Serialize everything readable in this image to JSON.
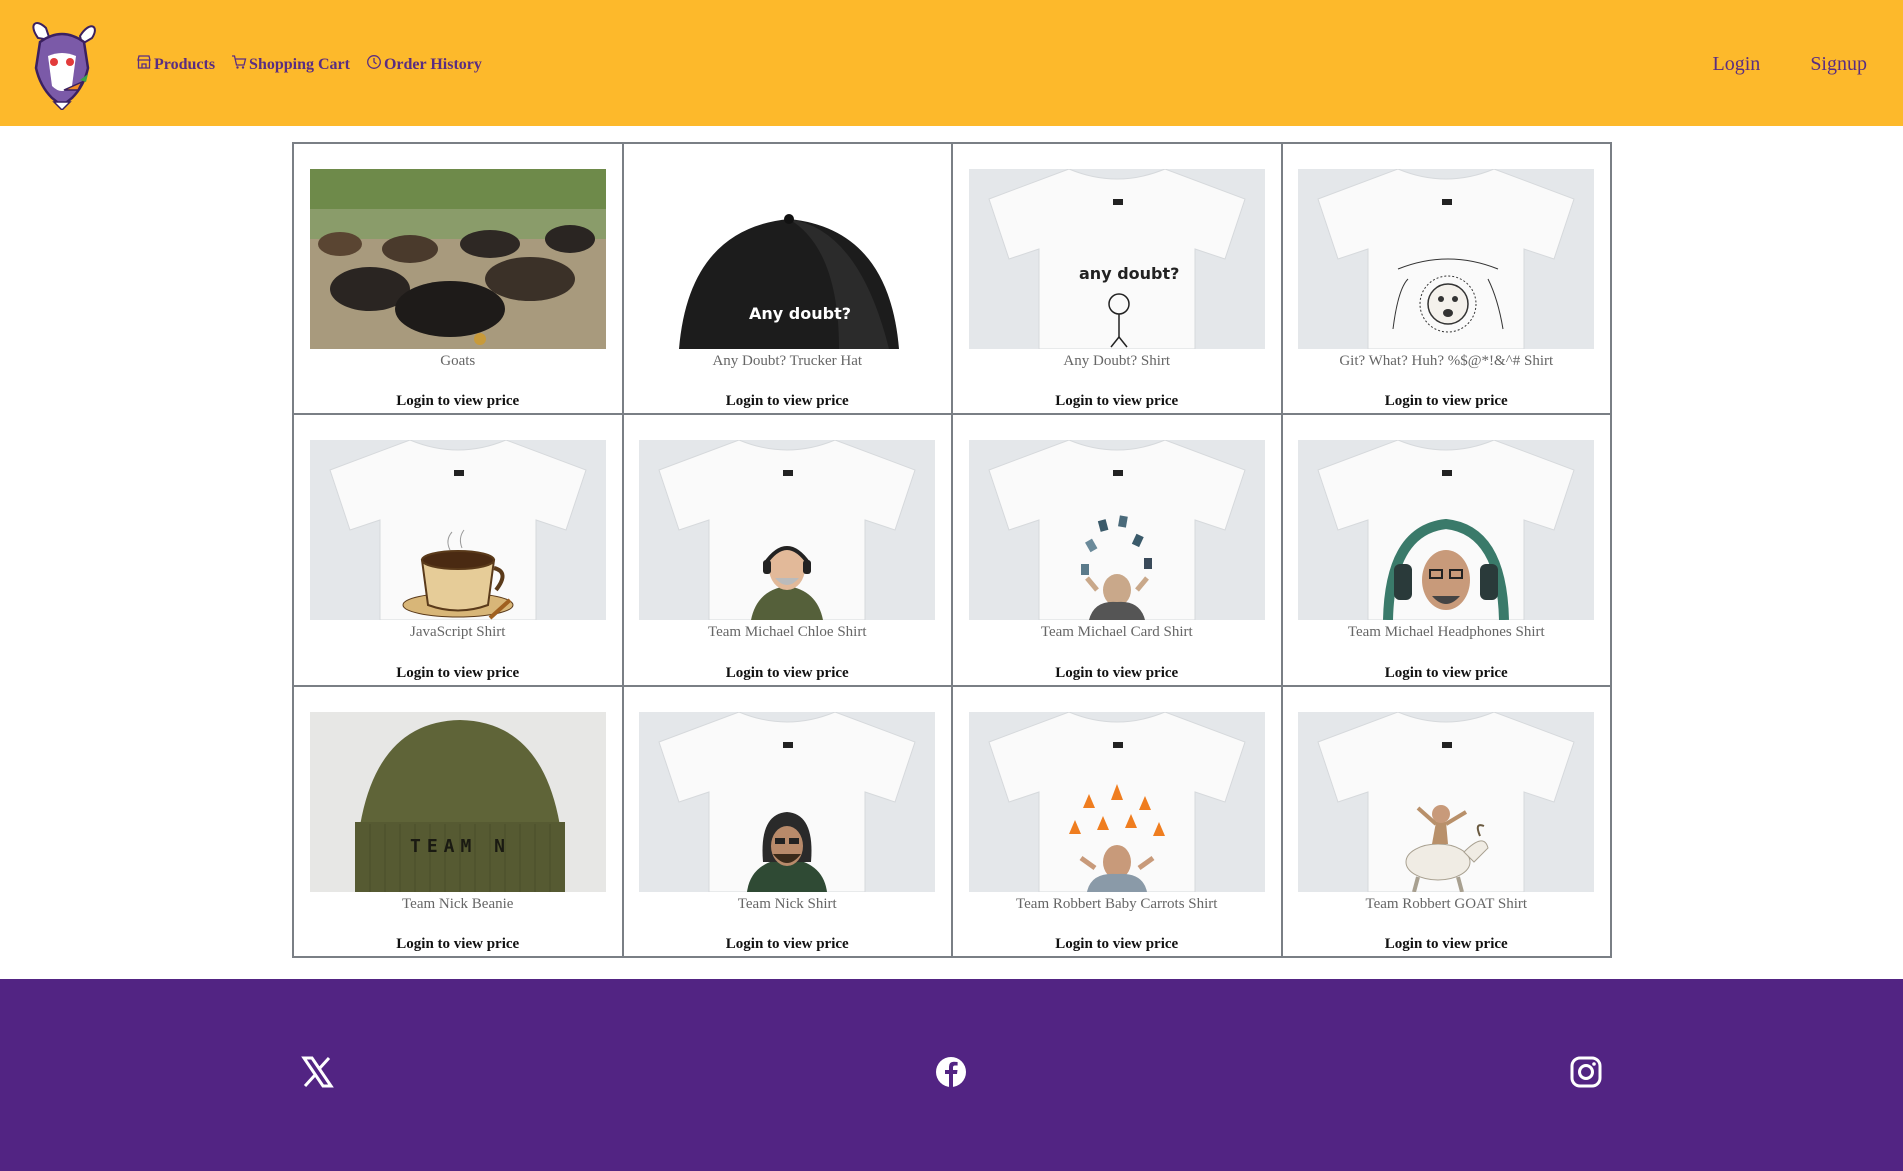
{
  "header": {
    "logo": "goat-logo",
    "nav": [
      {
        "label": "Products",
        "icon": "store-icon"
      },
      {
        "label": "Shopping Cart",
        "icon": "cart-icon"
      },
      {
        "label": "Order History",
        "icon": "clock-icon"
      }
    ],
    "auth": {
      "login": "Login",
      "signup": "Signup"
    }
  },
  "products": [
    {
      "name": "Goats",
      "price_text": "Login to view price",
      "image": "goat-herd-photo"
    },
    {
      "name": "Any Doubt? Trucker Hat",
      "price_text": "Login to view price",
      "image": "black-trucker-hat",
      "print": "Any doubt?"
    },
    {
      "name": "Any Doubt? Shirt",
      "price_text": "Login to view price",
      "image": "white-tshirt-any-doubt",
      "print": "any doubt?"
    },
    {
      "name": "Git? What? Huh? %$@*!&^# Shirt",
      "price_text": "Login to view price",
      "image": "white-tshirt-git-scribble"
    },
    {
      "name": "JavaScript Shirt",
      "price_text": "Login to view price",
      "image": "white-tshirt-coffee-cup"
    },
    {
      "name": "Team Michael Chloe Shirt",
      "price_text": "Login to view price",
      "image": "white-tshirt-man-headphones"
    },
    {
      "name": "Team Michael Card Shirt",
      "price_text": "Login to view price",
      "image": "white-tshirt-flying-cards"
    },
    {
      "name": "Team Michael Headphones Shirt",
      "price_text": "Login to view price",
      "image": "white-tshirt-headphones-portrait"
    },
    {
      "name": "Team Nick Beanie",
      "price_text": "Login to view price",
      "image": "olive-beanie",
      "print": "TEAM N"
    },
    {
      "name": "Team Nick Shirt",
      "price_text": "Login to view price",
      "image": "white-tshirt-hoodie-man"
    },
    {
      "name": "Team Robbert Baby Carrots Shirt",
      "price_text": "Login to view price",
      "image": "white-tshirt-carrots"
    },
    {
      "name": "Team Robbert GOAT Shirt",
      "price_text": "Login to view price",
      "image": "white-tshirt-goat-rider"
    }
  ],
  "footer": {
    "social": [
      {
        "icon": "x-icon"
      },
      {
        "icon": "facebook-icon"
      },
      {
        "icon": "instagram-icon"
      }
    ]
  },
  "colors": {
    "header_bg": "#fdb92b",
    "accent": "#5a2d82",
    "footer_bg": "#522483",
    "grid_border": "#7a7f85"
  }
}
